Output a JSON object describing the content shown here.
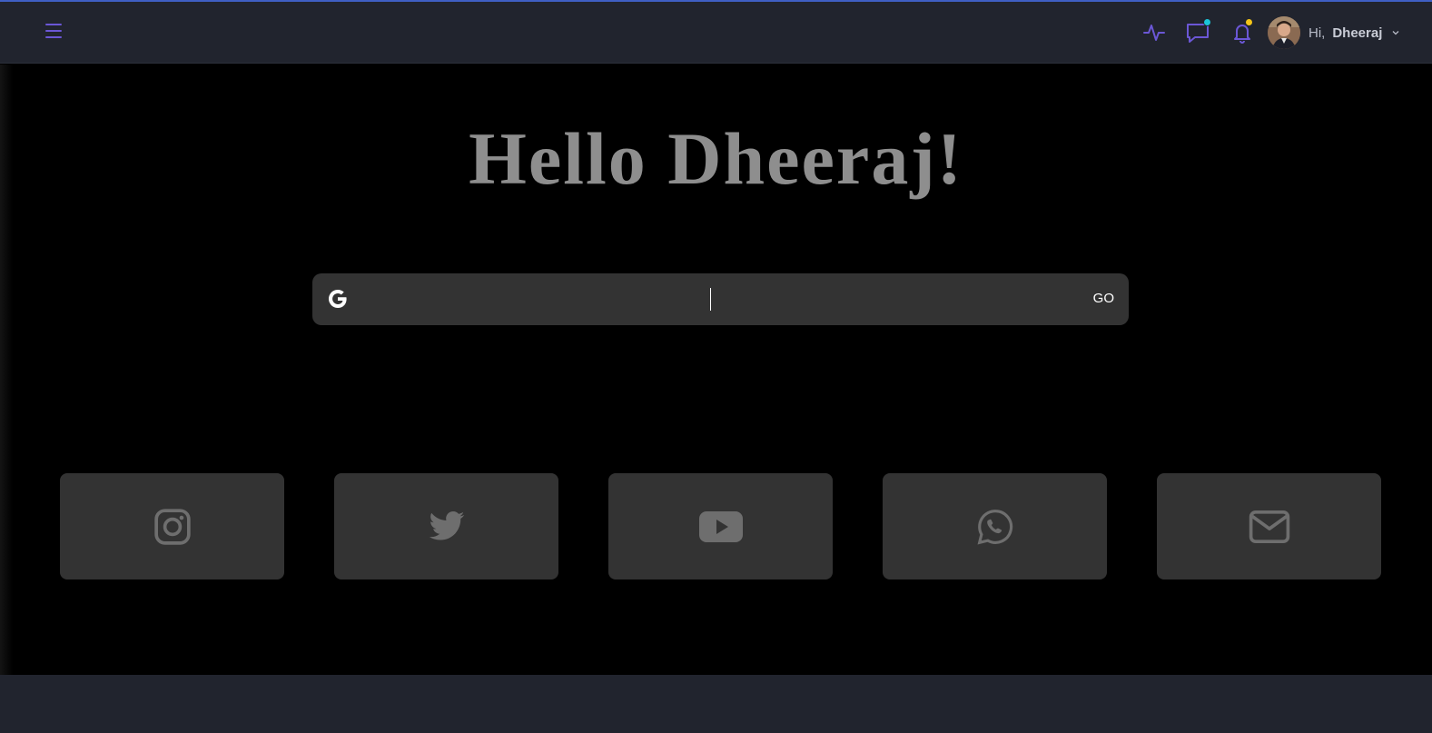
{
  "header": {
    "menu_icon": "hamburger-menu-icon",
    "activity_icon": "activity-pulse-icon",
    "chat_icon": "chat-bubble-icon",
    "bell_icon": "bell-icon",
    "chat_badge_color": "#1bc5d8",
    "bell_badge_color": "#f5c518",
    "accent_color": "#6b57d6",
    "user": {
      "greeting": "Hi,",
      "name": "Dheeraj",
      "avatar_icon": "user-avatar"
    }
  },
  "main": {
    "greeting_title": "Hello Dheeraj!",
    "search": {
      "engine_icon": "google-g-icon",
      "value": "",
      "placeholder": "",
      "button_label": "GO"
    },
    "shortcuts": [
      {
        "name": "Instagram",
        "icon": "instagram-icon"
      },
      {
        "name": "Twitter",
        "icon": "twitter-icon"
      },
      {
        "name": "YouTube",
        "icon": "youtube-icon"
      },
      {
        "name": "WhatsApp",
        "icon": "whatsapp-icon"
      },
      {
        "name": "Email",
        "icon": "mail-icon"
      }
    ],
    "tile_color": "#333333",
    "icon_color": "#6e6e6e"
  }
}
